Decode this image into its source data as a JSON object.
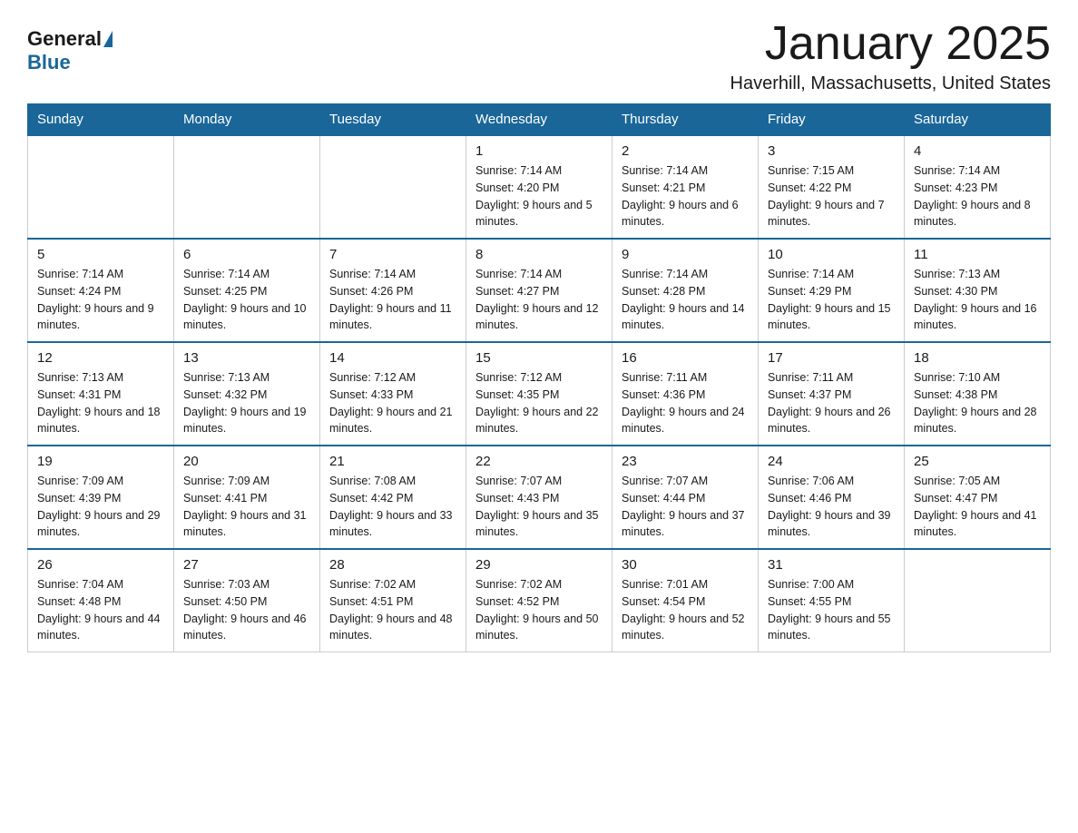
{
  "logo": {
    "general": "General",
    "blue": "Blue"
  },
  "header": {
    "title": "January 2025",
    "location": "Haverhill, Massachusetts, United States"
  },
  "weekdays": [
    "Sunday",
    "Monday",
    "Tuesday",
    "Wednesday",
    "Thursday",
    "Friday",
    "Saturday"
  ],
  "weeks": [
    [
      {
        "day": "",
        "info": ""
      },
      {
        "day": "",
        "info": ""
      },
      {
        "day": "",
        "info": ""
      },
      {
        "day": "1",
        "info": "Sunrise: 7:14 AM\nSunset: 4:20 PM\nDaylight: 9 hours and 5 minutes."
      },
      {
        "day": "2",
        "info": "Sunrise: 7:14 AM\nSunset: 4:21 PM\nDaylight: 9 hours and 6 minutes."
      },
      {
        "day": "3",
        "info": "Sunrise: 7:15 AM\nSunset: 4:22 PM\nDaylight: 9 hours and 7 minutes."
      },
      {
        "day": "4",
        "info": "Sunrise: 7:14 AM\nSunset: 4:23 PM\nDaylight: 9 hours and 8 minutes."
      }
    ],
    [
      {
        "day": "5",
        "info": "Sunrise: 7:14 AM\nSunset: 4:24 PM\nDaylight: 9 hours and 9 minutes."
      },
      {
        "day": "6",
        "info": "Sunrise: 7:14 AM\nSunset: 4:25 PM\nDaylight: 9 hours and 10 minutes."
      },
      {
        "day": "7",
        "info": "Sunrise: 7:14 AM\nSunset: 4:26 PM\nDaylight: 9 hours and 11 minutes."
      },
      {
        "day": "8",
        "info": "Sunrise: 7:14 AM\nSunset: 4:27 PM\nDaylight: 9 hours and 12 minutes."
      },
      {
        "day": "9",
        "info": "Sunrise: 7:14 AM\nSunset: 4:28 PM\nDaylight: 9 hours and 14 minutes."
      },
      {
        "day": "10",
        "info": "Sunrise: 7:14 AM\nSunset: 4:29 PM\nDaylight: 9 hours and 15 minutes."
      },
      {
        "day": "11",
        "info": "Sunrise: 7:13 AM\nSunset: 4:30 PM\nDaylight: 9 hours and 16 minutes."
      }
    ],
    [
      {
        "day": "12",
        "info": "Sunrise: 7:13 AM\nSunset: 4:31 PM\nDaylight: 9 hours and 18 minutes."
      },
      {
        "day": "13",
        "info": "Sunrise: 7:13 AM\nSunset: 4:32 PM\nDaylight: 9 hours and 19 minutes."
      },
      {
        "day": "14",
        "info": "Sunrise: 7:12 AM\nSunset: 4:33 PM\nDaylight: 9 hours and 21 minutes."
      },
      {
        "day": "15",
        "info": "Sunrise: 7:12 AM\nSunset: 4:35 PM\nDaylight: 9 hours and 22 minutes."
      },
      {
        "day": "16",
        "info": "Sunrise: 7:11 AM\nSunset: 4:36 PM\nDaylight: 9 hours and 24 minutes."
      },
      {
        "day": "17",
        "info": "Sunrise: 7:11 AM\nSunset: 4:37 PM\nDaylight: 9 hours and 26 minutes."
      },
      {
        "day": "18",
        "info": "Sunrise: 7:10 AM\nSunset: 4:38 PM\nDaylight: 9 hours and 28 minutes."
      }
    ],
    [
      {
        "day": "19",
        "info": "Sunrise: 7:09 AM\nSunset: 4:39 PM\nDaylight: 9 hours and 29 minutes."
      },
      {
        "day": "20",
        "info": "Sunrise: 7:09 AM\nSunset: 4:41 PM\nDaylight: 9 hours and 31 minutes."
      },
      {
        "day": "21",
        "info": "Sunrise: 7:08 AM\nSunset: 4:42 PM\nDaylight: 9 hours and 33 minutes."
      },
      {
        "day": "22",
        "info": "Sunrise: 7:07 AM\nSunset: 4:43 PM\nDaylight: 9 hours and 35 minutes."
      },
      {
        "day": "23",
        "info": "Sunrise: 7:07 AM\nSunset: 4:44 PM\nDaylight: 9 hours and 37 minutes."
      },
      {
        "day": "24",
        "info": "Sunrise: 7:06 AM\nSunset: 4:46 PM\nDaylight: 9 hours and 39 minutes."
      },
      {
        "day": "25",
        "info": "Sunrise: 7:05 AM\nSunset: 4:47 PM\nDaylight: 9 hours and 41 minutes."
      }
    ],
    [
      {
        "day": "26",
        "info": "Sunrise: 7:04 AM\nSunset: 4:48 PM\nDaylight: 9 hours and 44 minutes."
      },
      {
        "day": "27",
        "info": "Sunrise: 7:03 AM\nSunset: 4:50 PM\nDaylight: 9 hours and 46 minutes."
      },
      {
        "day": "28",
        "info": "Sunrise: 7:02 AM\nSunset: 4:51 PM\nDaylight: 9 hours and 48 minutes."
      },
      {
        "day": "29",
        "info": "Sunrise: 7:02 AM\nSunset: 4:52 PM\nDaylight: 9 hours and 50 minutes."
      },
      {
        "day": "30",
        "info": "Sunrise: 7:01 AM\nSunset: 4:54 PM\nDaylight: 9 hours and 52 minutes."
      },
      {
        "day": "31",
        "info": "Sunrise: 7:00 AM\nSunset: 4:55 PM\nDaylight: 9 hours and 55 minutes."
      },
      {
        "day": "",
        "info": ""
      }
    ]
  ]
}
